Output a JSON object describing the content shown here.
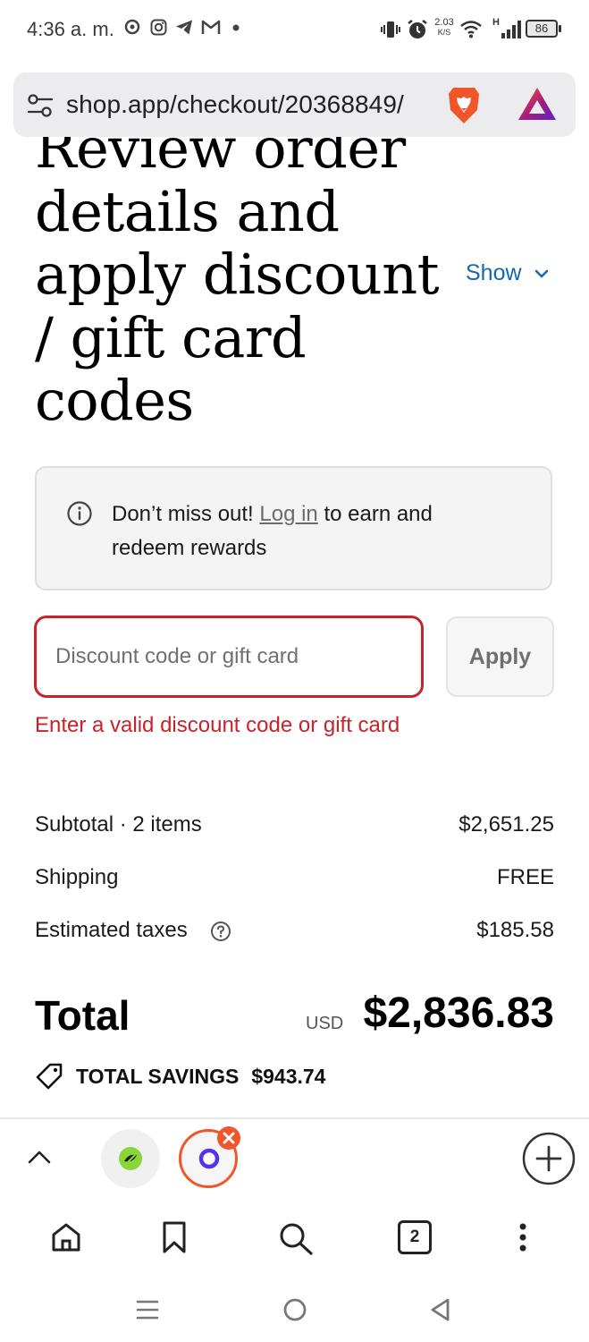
{
  "status_bar": {
    "time": "4:36 a. m.",
    "network_speed": "2.03",
    "network_speed_unit": "K/S",
    "signal_type": "H",
    "battery": "86"
  },
  "url_bar": {
    "url": "shop.app/checkout/20368849/"
  },
  "order_summary": {
    "heading": "Review order details and apply discount / gift card codes",
    "toggle_label": "Show"
  },
  "rewards_notice": {
    "prefix": "Don’t miss out! ",
    "link": "Log in",
    "suffix": " to earn and redeem rewards"
  },
  "discount": {
    "placeholder": "Discount code or gift card",
    "value": "",
    "apply_label": "Apply",
    "error": "Enter a valid discount code or gift card"
  },
  "summary": {
    "subtotal_label": "Subtotal · 2 items",
    "subtotal_value": "$2,651.25",
    "shipping_label": "Shipping",
    "shipping_value": "FREE",
    "taxes_label": "Estimated taxes",
    "taxes_value": "$185.58",
    "total_label": "Total",
    "total_currency": "USD",
    "total_value": "$2,836.83",
    "savings_label": "TOTAL SAVINGS",
    "savings_value": "$943.74"
  },
  "browser_nav": {
    "tab_count": "2"
  },
  "colors": {
    "error": "#c8232b",
    "link": "#1268b3",
    "brave_orange": "#f1562b"
  },
  "icons": [
    "tune-icon",
    "brave-lion-icon",
    "brave-rewards-triangle-icon",
    "info-icon",
    "help-icon",
    "tag-icon",
    "chevron-up-icon",
    "plus-icon",
    "home-icon",
    "bookmark-icon",
    "search-icon",
    "tabs-icon",
    "more-vert-icon",
    "menu-icon",
    "home-circle-icon",
    "back-icon"
  ]
}
